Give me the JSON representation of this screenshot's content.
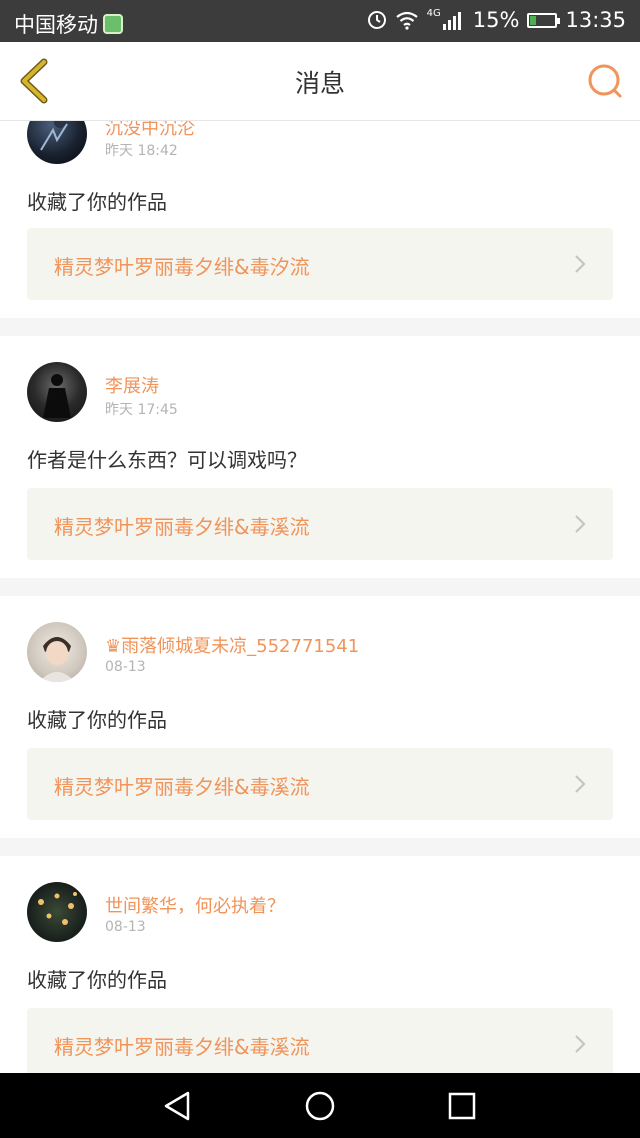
{
  "status_bar": {
    "carrier": "中国移动",
    "network": "4G",
    "battery": "15%",
    "time": "13:35"
  },
  "nav": {
    "title": "消息"
  },
  "messages": [
    {
      "user": "沉没中沉沦",
      "time": "昨天 18:42",
      "text": "收藏了你的作品",
      "work_title": "精灵梦叶罗丽毒夕绯&毒汐流"
    },
    {
      "user": "李展涛",
      "time": "昨天 17:45",
      "text": "作者是什么东西？可以调戏吗？",
      "work_title": "精灵梦叶罗丽毒夕绯&毒溪流"
    },
    {
      "user": "♛雨落倾城夏未凉_552771541",
      "time": "08-13",
      "text": "收藏了你的作品",
      "work_title": "精灵梦叶罗丽毒夕绯&毒溪流"
    },
    {
      "user": "世间繁华，何必执着？",
      "time": "08-13",
      "text": "收藏了你的作品",
      "work_title": "精灵梦叶罗丽毒夕绯&毒溪流"
    }
  ],
  "colors": {
    "accent": "#f0945a",
    "nav_back": "#c9a227"
  },
  "icons": {
    "back": "chevron-left-icon",
    "search": "search-icon",
    "system_back": "triangle-back-icon",
    "system_home": "circle-home-icon",
    "system_recent": "square-recent-icon"
  }
}
